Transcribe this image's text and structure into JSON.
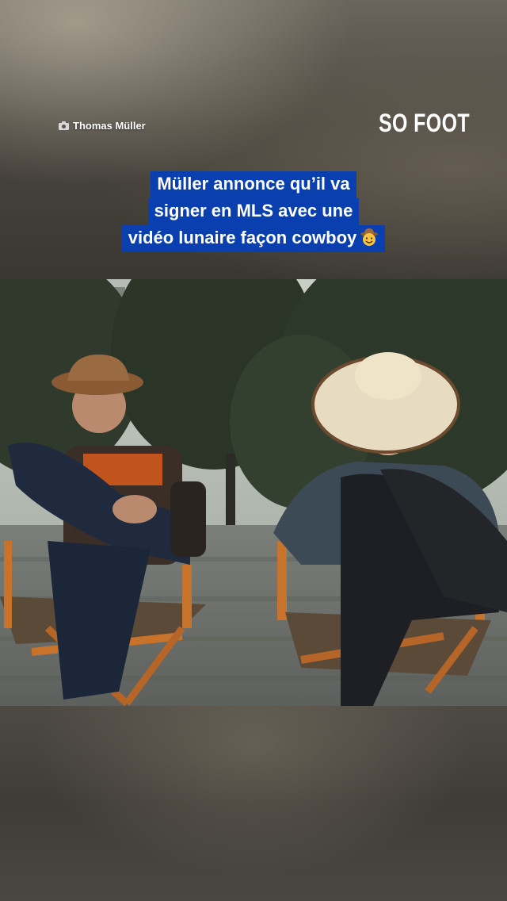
{
  "credit": {
    "icon": "camera-icon",
    "label": "Thomas Müller"
  },
  "logo": {
    "text": "SO FOOT"
  },
  "headline": {
    "line1": "Müller annonce qu’il va",
    "line2": "signer en MLS avec une",
    "line3": "vidéo lunaire façon cowboy",
    "emoji": "cowboy-face-emoji",
    "background_color": "#0a3fb0"
  },
  "video": {
    "description_icon": "video-frame"
  }
}
